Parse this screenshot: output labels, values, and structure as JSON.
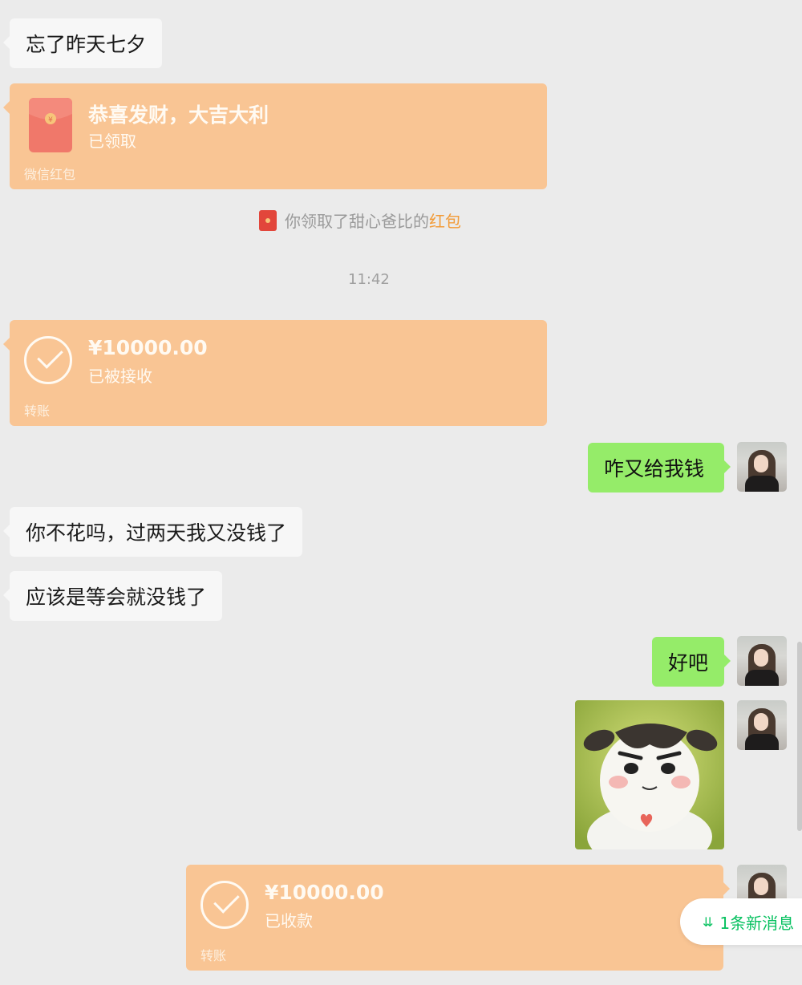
{
  "messages": {
    "m1_text": "忘了昨天七夕",
    "red_packet": {
      "title": "恭喜发财，大吉大利",
      "status": "已领取",
      "footer": "微信红包"
    },
    "system_notice": {
      "prefix": "你领取了甜心爸比的",
      "link": "红包"
    },
    "timestamp": "11:42",
    "transfer_in": {
      "amount": "¥10000.00",
      "status": "已被接收",
      "footer": "转账"
    },
    "out1_text": "咋又给我钱",
    "in2_text": "你不花吗，过两天我又没钱了",
    "in3_text": "应该是等会就没钱了",
    "out2_text": "好吧",
    "transfer_out": {
      "amount": "¥10000.00",
      "status": "已收款",
      "footer": "转账"
    }
  },
  "new_messages_pill": "1条新消息",
  "colors": {
    "chat_background": "#ebebeb",
    "incoming_bubble": "#f7f7f7",
    "outgoing_bubble": "#95ec69",
    "received_card": "#f9c594",
    "accent_green": "#07c160",
    "red_packet_link": "#f29b38"
  }
}
